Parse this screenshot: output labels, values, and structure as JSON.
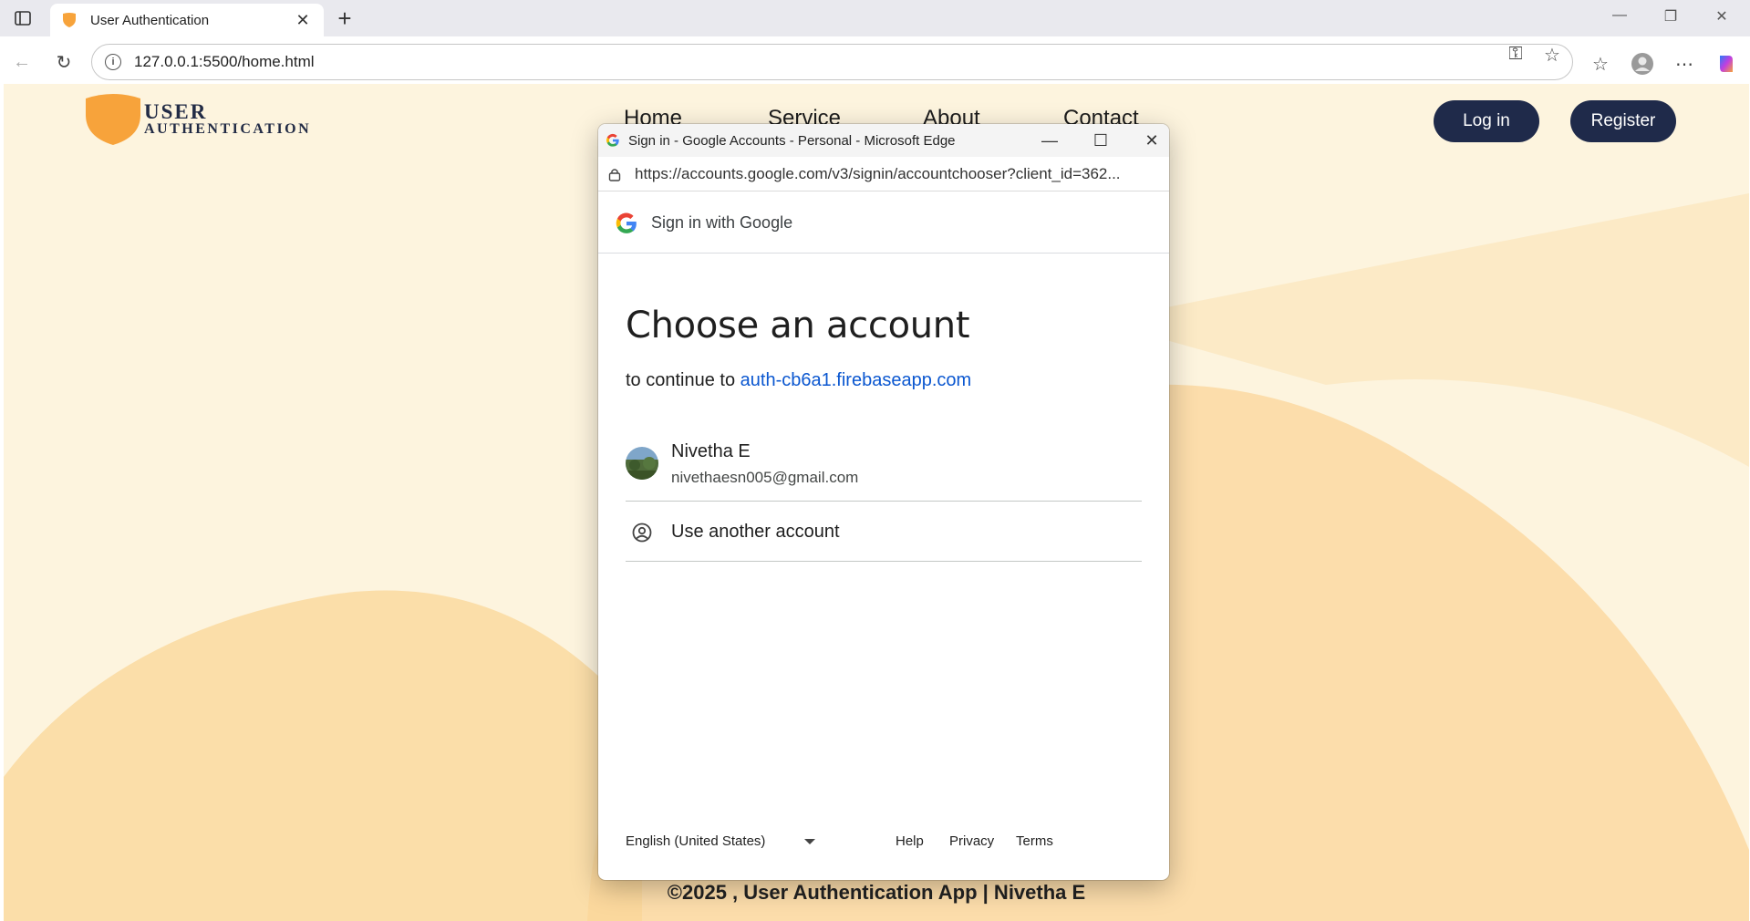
{
  "browser": {
    "tab_title": "User Authentication",
    "url": "127.0.0.1:5500/home.html",
    "icons": [
      "sidebar-icon",
      "shield-favicon",
      "close-icon",
      "plus-icon",
      "minimize-icon",
      "restore-icon",
      "back-icon",
      "refresh-icon",
      "info-icon",
      "key-icon",
      "star-icon",
      "favorites-icon",
      "profile-icon",
      "more-icon",
      "copilot-icon"
    ]
  },
  "site": {
    "logo_line1": "USER",
    "logo_line2": "AUTHENTICATION",
    "nav": [
      "Home",
      "Service",
      "About",
      "Contact"
    ],
    "login_label": "Log in",
    "register_label": "Register",
    "footer": "©2025 , User Authentication App | Nivetha E",
    "accent_color": "#f7a33b",
    "button_color": "#1f2a4a"
  },
  "popup": {
    "window_title": "Sign in - Google Accounts - Personal - Microsoft Edge",
    "url": "https://accounts.google.com/v3/signin/accountchooser?client_id=362...",
    "header": "Sign in with Google",
    "heading": "Choose an account",
    "continue_prefix": "to continue to",
    "continue_link": "auth-cb6a1.firebaseapp.com",
    "account_name": "Nivetha E",
    "account_email": "nivethaesn005@gmail.com",
    "another_account": "Use another account",
    "language": "English (United States)",
    "help": "Help",
    "privacy": "Privacy",
    "terms": "Terms"
  }
}
